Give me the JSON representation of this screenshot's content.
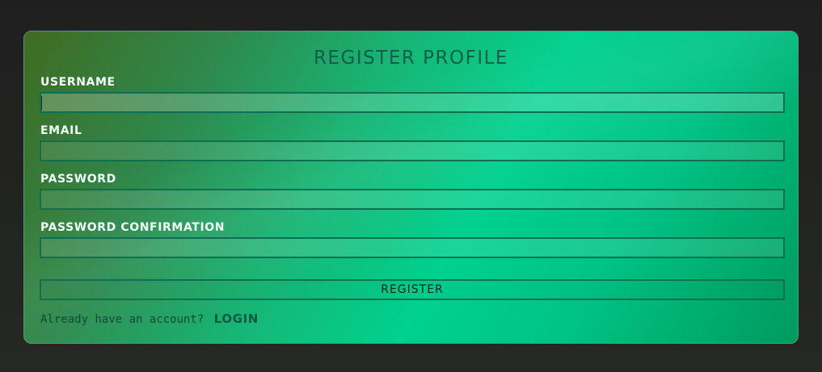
{
  "form": {
    "title": "REGISTER PROFILE",
    "fields": [
      {
        "label": "USERNAME",
        "value": ""
      },
      {
        "label": "EMAIL",
        "value": ""
      },
      {
        "label": "PASSWORD",
        "value": ""
      },
      {
        "label": "PASSWORD CONFIRMATION",
        "value": ""
      }
    ],
    "submit_label": "REGISTER",
    "footer_text": "Already have an account?",
    "login_label": "LOGIN"
  },
  "colors": {
    "accent": "#00d18e",
    "title": "#0d5e4a",
    "label": "#f2fff8",
    "border": "#0f6f50",
    "page_background": "#1f1f1f"
  }
}
